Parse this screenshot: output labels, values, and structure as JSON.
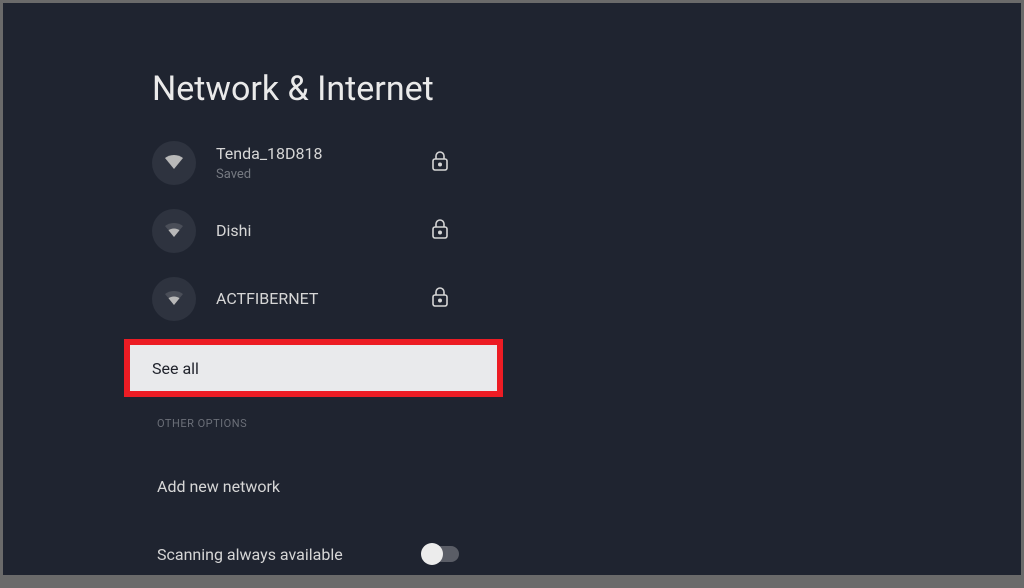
{
  "title": "Network & Internet",
  "networks": [
    {
      "name": "Tenda_18D818",
      "status": "Saved",
      "locked": true,
      "signal": "strong"
    },
    {
      "name": "Dishi",
      "status": "",
      "locked": true,
      "signal": "medium"
    },
    {
      "name": "ACTFIBERNET",
      "status": "",
      "locked": true,
      "signal": "medium"
    }
  ],
  "see_all_label": "See all",
  "section_header": "OTHER OPTIONS",
  "options": {
    "add_network": "Add new network",
    "scanning": "Scanning always available"
  },
  "scanning_enabled": false
}
